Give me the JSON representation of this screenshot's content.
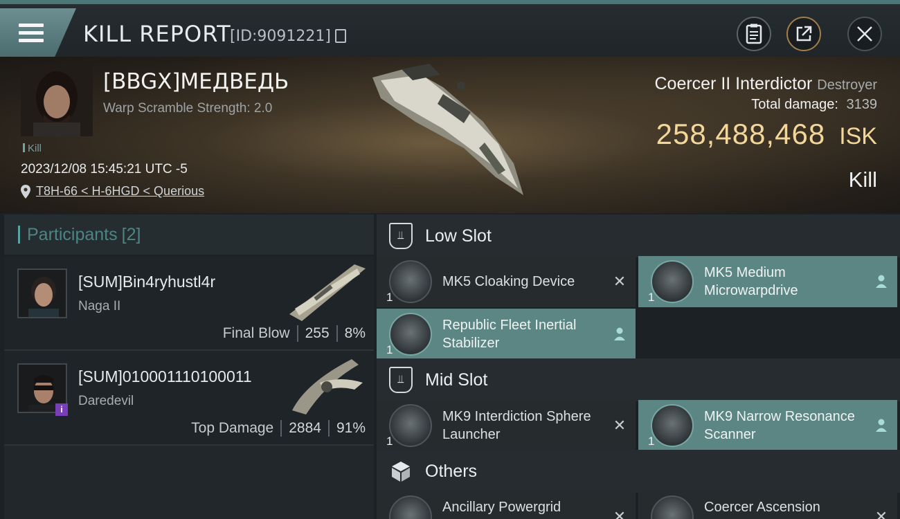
{
  "header": {
    "title": "KILL REPORT",
    "report_id": "[ID:9091221]"
  },
  "victim": {
    "name": "[BBGX]МЕДВЕДЬ",
    "warp_scramble": "Warp Scramble Strength: 2.0",
    "kill_tag": "Kill",
    "datetime": "2023/12/08 15:45:21 UTC -5",
    "location": "T8H-66 < H-6HGD < Querious"
  },
  "ship": {
    "name": "Coercer II Interdictor",
    "class": "Destroyer",
    "total_damage_label": "Total damage:",
    "total_damage": "3139",
    "isk_value": "258,488,468",
    "isk_unit": "ISK",
    "outcome": "Kill"
  },
  "participants": {
    "label": "Participants",
    "count": "[2]",
    "list": [
      {
        "name": "[SUM]Bin4ryhustl4r",
        "ship": "Naga II",
        "role": "Final Blow",
        "damage": "255",
        "percent": "8%"
      },
      {
        "name": "[SUM]010001110100011",
        "ship": "Daredevil",
        "role": "Top Damage",
        "damage": "2884",
        "percent": "91%"
      }
    ]
  },
  "fitting": {
    "low_slot": {
      "label": "Low Slot",
      "modules": [
        {
          "name": "MK5 Cloaking Device",
          "qty": "1",
          "state": "destroyed"
        },
        {
          "name": "MK5 Medium Microwarpdrive",
          "qty": "1",
          "state": "dropped"
        },
        {
          "name": "Republic Fleet Inertial Stabilizer",
          "qty": "1",
          "state": "dropped"
        }
      ]
    },
    "mid_slot": {
      "label": "Mid Slot",
      "modules": [
        {
          "name": "MK9 Interdiction Sphere Launcher",
          "qty": "1",
          "state": "destroyed"
        },
        {
          "name": "MK9 Narrow Resonance Scanner",
          "qty": "1",
          "state": "dropped"
        }
      ]
    },
    "others": {
      "label": "Others",
      "modules": [
        {
          "name": "Ancillary Powergrid",
          "qty": "",
          "state": "destroyed"
        },
        {
          "name": "Coercer Ascension",
          "qty": "",
          "state": "destroyed"
        }
      ]
    }
  },
  "colors": {
    "accent_teal": "#5b8684",
    "isk_gold": "#f3d79a",
    "header_stripe": "#4b7777"
  },
  "icons": {
    "menu": "hamburger-icon",
    "copy": "copy-icon",
    "clipboard": "clipboard-icon",
    "share": "share-icon",
    "close": "close-icon",
    "location": "location-pin-icon",
    "destroyed": "x-icon",
    "dropped": "person-icon"
  }
}
